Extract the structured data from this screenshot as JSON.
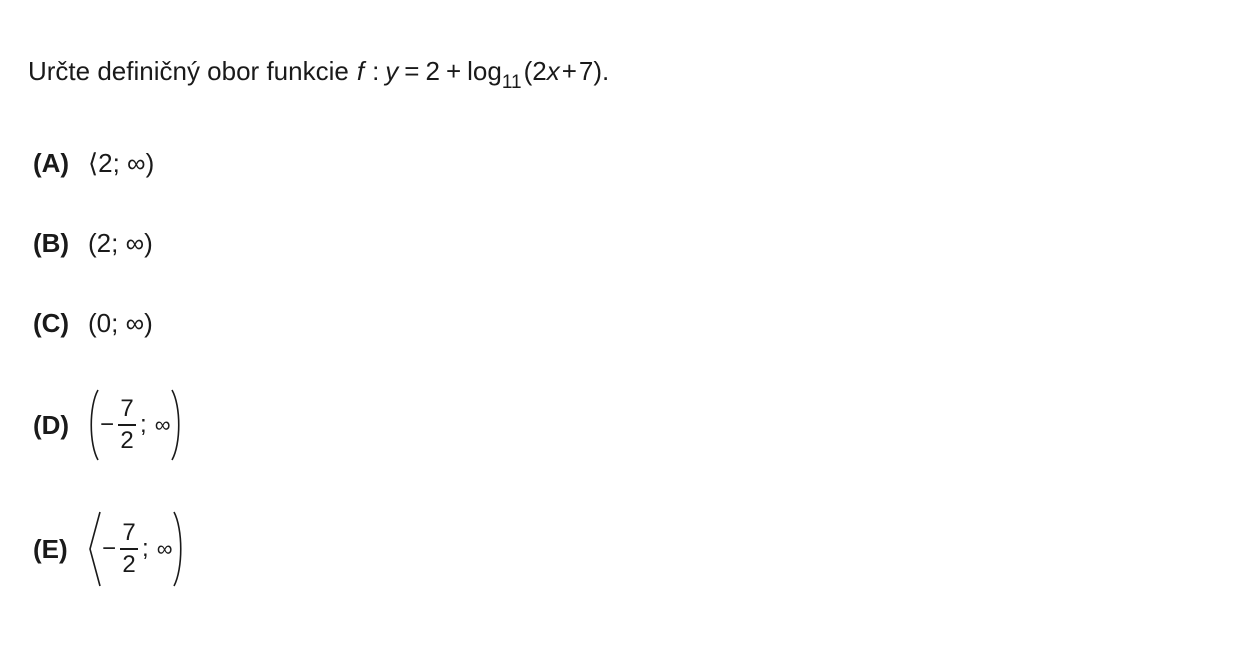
{
  "question": {
    "text": "Určte definičný obor funkcie",
    "f": "f",
    "colon": ":",
    "y": "y",
    "eq": "=",
    "two": "2",
    "plus": "+",
    "log": "log",
    "base": "11",
    "open": "(",
    "arg_2": "2",
    "arg_x": "x",
    "arg_plus": "+",
    "arg_7": "7",
    "close": ").",
    "period": ""
  },
  "options": [
    {
      "label": "(A)",
      "interval": "⟨2; ∞)"
    },
    {
      "label": "(B)",
      "interval": "(2; ∞)"
    },
    {
      "label": "(C)",
      "interval": "(0; ∞)"
    },
    {
      "label": "(D)",
      "minus": "−",
      "num": "7",
      "den": "2",
      "semi": ";",
      "inf": "∞"
    },
    {
      "label": "(E)",
      "minus": "−",
      "num": "7",
      "den": "2",
      "semi": ";",
      "inf": "∞"
    }
  ]
}
